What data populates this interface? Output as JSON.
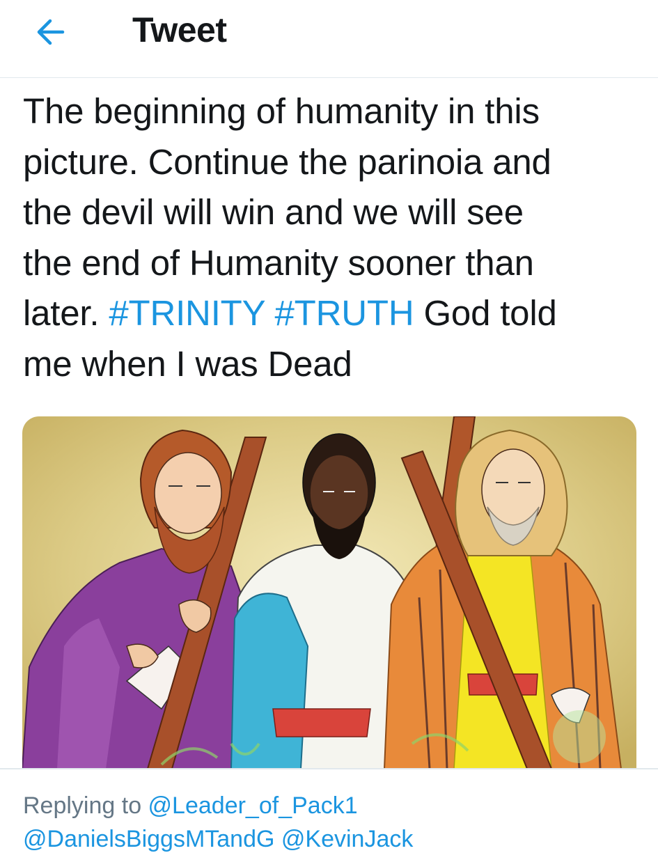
{
  "header": {
    "back_icon": "arrow-left-icon",
    "title": "Tweet"
  },
  "tweet": {
    "lines": [
      "The beginning of humanity in this",
      "picture. Continue the parinoia and",
      "the devil will win and we will see",
      "the end of Humanity sooner than"
    ],
    "line5_prefix": "later. ",
    "hashtags": [
      "#TRINITY",
      "#TRUTH"
    ],
    "line5_suffix": " God told",
    "line6": "me when I was Dead"
  },
  "media": {
    "icon": "image-icon"
  },
  "reply": {
    "prefix": "Replying to ",
    "mention": "@Leader_of_Pack1",
    "second_line": "@DanielsBiggsMTandG @KevinJack"
  },
  "colors": {
    "accent": "#1b95e0",
    "text": "#14171a",
    "secondary": "#657786",
    "border": "#e1e8ed"
  }
}
